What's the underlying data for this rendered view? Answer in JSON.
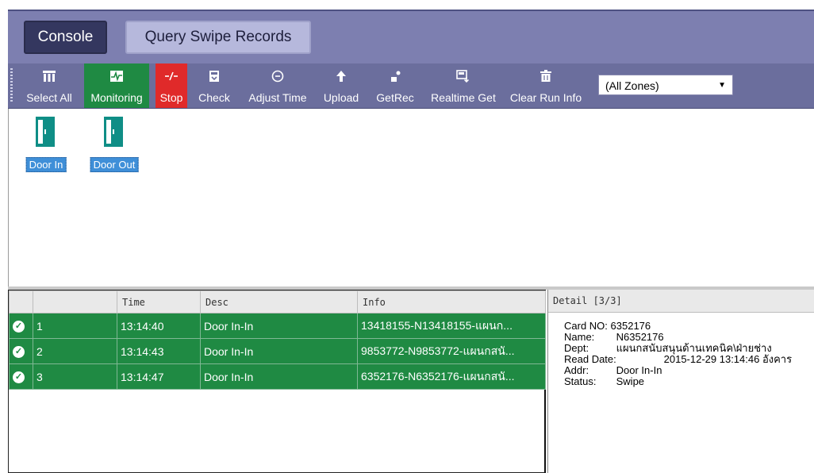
{
  "tabs": {
    "console": "Console",
    "query": "Query Swipe Records"
  },
  "toolbar": {
    "buttons": [
      {
        "label": "Select All",
        "icon": "select-all-icon"
      },
      {
        "label": "Monitoring",
        "icon": "monitoring-icon",
        "state": "active"
      },
      {
        "label": "Stop",
        "icon": "stop-icon",
        "state": "active"
      },
      {
        "label": "Check",
        "icon": "check-icon"
      },
      {
        "label": "Adjust Time",
        "icon": "clock-icon"
      },
      {
        "label": "Upload",
        "icon": "upload-arrow-icon"
      },
      {
        "label": "GetRec",
        "icon": "get-records-icon"
      },
      {
        "label": "Realtime Get",
        "icon": "realtime-get-icon"
      },
      {
        "label": "Clear Run Info",
        "icon": "trash-icon"
      }
    ],
    "zone_select": {
      "value": "(All Zones)"
    }
  },
  "doors": [
    {
      "label": "Door In"
    },
    {
      "label": "Door Out"
    }
  ],
  "records": {
    "columns": [
      "",
      "Time",
      "Desc",
      "Info"
    ],
    "rows": [
      {
        "no": "1",
        "time": "13:14:40",
        "desc": "Door In-In",
        "info": "13418155-N13418155-แผนก..."
      },
      {
        "no": "2",
        "time": "13:14:43",
        "desc": "Door In-In",
        "info": "9853772-N9853772-แผนกสนั..."
      },
      {
        "no": "3",
        "time": "13:14:47",
        "desc": "Door In-In",
        "info": "6352176-N6352176-แผนกสนั..."
      }
    ]
  },
  "detail": {
    "header": "Detail  [3/3]",
    "card_no_label": "Card NO:",
    "card_no": "6352176",
    "name_label": "Name:",
    "name": "N6352176",
    "dept_label": "Dept:",
    "dept": "แผนกสนับสนุนด้านเทคนิค\\ฝ่ายช่าง",
    "read_date_label": "Read Date:",
    "read_date": "2015-12-29 13:14:46 อังคาร",
    "addr_label": "Addr:",
    "addr": "Door In-In",
    "status_label": "Status:",
    "status": "Swipe"
  },
  "colors": {
    "green": "#1f8a43",
    "red": "#e02a2a",
    "toolbar": "#6b6e9d",
    "header": "#7d7fb0"
  }
}
